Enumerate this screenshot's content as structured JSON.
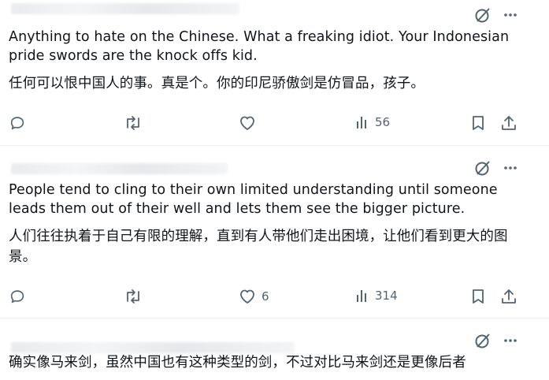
{
  "tweets": [
    {
      "text_en": "Anything to hate on the Chinese. What a freaking idiot. Your Indonesian pride swords are the knock offs kid.",
      "text_cn": "任何可以恨中国人的事。真是个。你的印尼骄傲剑是仿冒品，孩子。",
      "likes": "",
      "views": "56"
    },
    {
      "text_en": "People tend to cling to their own limited understanding until someone leads them out of their well and lets them see the bigger picture.",
      "text_cn": "人们往往执着于自己有限的理解，直到有人带他们走出困境，让他们看到更大的图景。",
      "likes": "6",
      "views": "314"
    },
    {
      "text_cn": "确实像马来剑，虽然中国也有这种类型的剑，不过对比马来剑还是更像后者"
    }
  ],
  "icons": {
    "grok": "grok-icon",
    "more": "more-icon",
    "reply": "reply-icon",
    "retweet": "retweet-icon",
    "like": "like-icon",
    "views": "views-icon",
    "bookmark": "bookmark-icon",
    "share": "share-icon"
  },
  "colors": {
    "text": "#0f1419",
    "muted": "#536471",
    "divider": "#eff3f4"
  }
}
